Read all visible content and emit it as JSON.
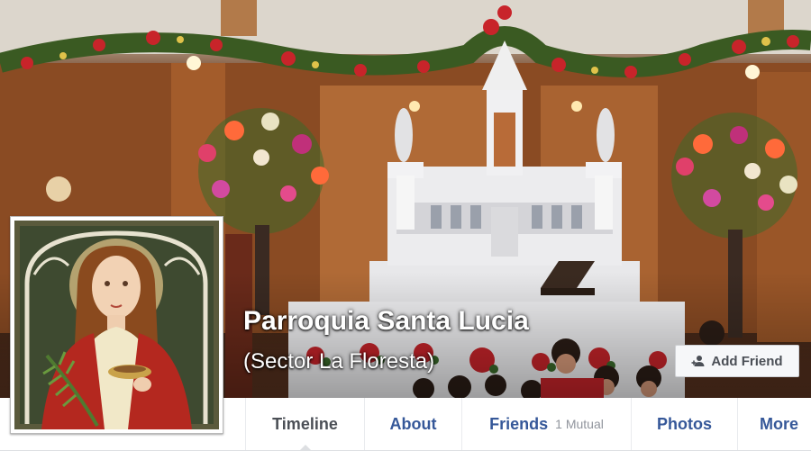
{
  "page": {
    "name": "Parroquia Santa Lucia",
    "subtitle": "(Sector La Floresta)"
  },
  "actions": {
    "add_friend_label": "Add Friend",
    "add_friend_icon": "add-person-icon"
  },
  "nav": {
    "timeline": "Timeline",
    "about": "About",
    "friends": "Friends",
    "friends_mutual": "1 Mutual",
    "photos": "Photos",
    "more": "More"
  },
  "colors": {
    "link_blue": "#365899",
    "active_tab": "#4b4f56",
    "button_bg": "#f6f7f9"
  }
}
